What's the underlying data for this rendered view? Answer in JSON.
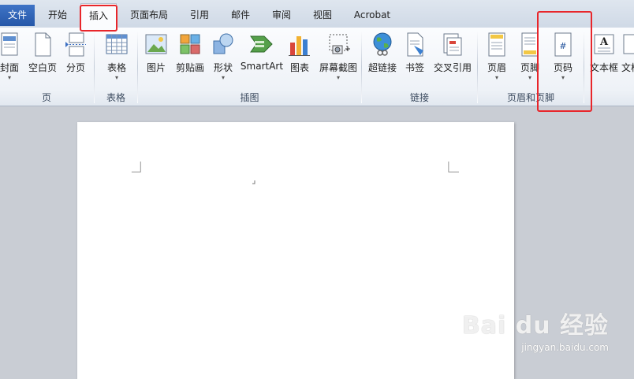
{
  "tabs": {
    "file": "文件",
    "home": "开始",
    "insert": "插入",
    "layout": "页面布局",
    "references": "引用",
    "mailings": "邮件",
    "review": "审阅",
    "view": "视图",
    "acrobat": "Acrobat"
  },
  "ribbon": {
    "pages": {
      "cover": "封面",
      "blank": "空白页",
      "break": "分页",
      "group": "页"
    },
    "tables": {
      "table": "表格",
      "group": "表格"
    },
    "illustrations": {
      "picture": "图片",
      "clipart": "剪贴画",
      "shapes": "形状",
      "smartart": "SmartArt",
      "chart": "图表",
      "screenshot": "屏幕截图",
      "group": "插图"
    },
    "links": {
      "hyperlink": "超链接",
      "bookmark": "书签",
      "crossref": "交叉引用",
      "group": "链接"
    },
    "header_footer": {
      "header": "页眉",
      "footer": "页脚",
      "page_number": "页码",
      "group": "页眉和页脚"
    },
    "text": {
      "textbox": "文本框",
      "quickparts": "文档"
    },
    "dropdown_arrow": "▾"
  },
  "watermark": {
    "brand": "Bai du 经验",
    "url": "jingyan.baidu.com"
  },
  "colors": {
    "highlight": "#e8262b",
    "file_tab": "#2b5fae"
  }
}
